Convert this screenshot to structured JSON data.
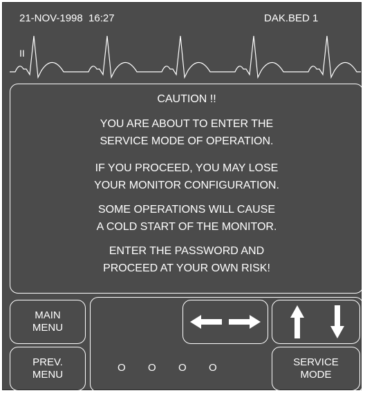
{
  "header": {
    "datetime": "21-NOV-1998  16:27",
    "bed": "DAK.BED 1"
  },
  "waveform": {
    "lead_label": "II"
  },
  "dialog": {
    "title": "CAUTION !!",
    "lines": [
      "YOU ARE ABOUT TO ENTER THE",
      "SERVICE MODE OF OPERATION.",
      "IF YOU PROCEED, YOU MAY LOSE",
      "YOUR MONITOR CONFIGURATION.",
      "SOME OPERATIONS WILL CAUSE",
      "A COLD START OF THE MONITOR.",
      "ENTER THE PASSWORD AND",
      "PROCEED AT YOUR OWN RISK!"
    ]
  },
  "buttons": {
    "main_menu": [
      "MAIN",
      "MENU"
    ],
    "prev_menu": [
      "PREV.",
      "MENU"
    ],
    "service_mode": [
      "SERVICE",
      "MODE"
    ]
  },
  "password": {
    "placeholders": [
      "O",
      "O",
      "O",
      "O"
    ]
  },
  "icons": {
    "left_right": "left-right-arrows-icon",
    "up_down": "up-down-arrows-icon"
  },
  "colors": {
    "screen_bg": "#4b4b4b",
    "foreground": "#ffffff"
  }
}
